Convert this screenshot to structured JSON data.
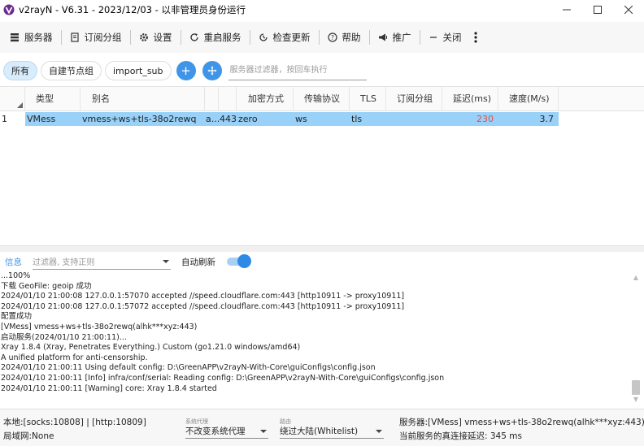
{
  "window": {
    "title": "v2rayN - V6.31 - 2023/12/03 - 以非管理员身份运行"
  },
  "toolbar": {
    "servers": "服务器",
    "subscriptions": "订阅分组",
    "settings": "设置",
    "restart": "重启服务",
    "check_update": "检查更新",
    "help": "帮助",
    "promote": "推广",
    "close": "关闭"
  },
  "filters": {
    "all": "所有",
    "custom_group": "自建节点组",
    "import_sub": "import_sub",
    "add": "+",
    "server_filter_placeholder": "服务器过滤器，按回车执行"
  },
  "grid": {
    "columns": [
      "类型",
      "别名",
      "",
      "",
      "加密方式",
      "传输协议",
      "TLS",
      "订阅分组",
      "延迟(ms)",
      "速度(M/s)"
    ],
    "rows": [
      {
        "index": "1",
        "type": "VMess",
        "alias": "vmess+ws+tls-38o2rewq",
        "address": "a...",
        "port": "443",
        "security": "zero",
        "network": "ws",
        "tls": "tls",
        "sub": "",
        "delay": "230",
        "speed": "3.7"
      }
    ]
  },
  "log_panel": {
    "tab": "信息",
    "filter_placeholder": "过滤器, 支持正则",
    "auto_refresh_label": "自动刷新",
    "auto_refresh_on": true,
    "lines": [
      "...100%",
      "下载 GeoFile: geoip 成功",
      "2024/01/10 21:00:08 127.0.0.1:57070 accepted //speed.cloudflare.com:443 [http10911 -> proxy10911]",
      "2024/01/10 21:00:08 127.0.0.1:57072 accepted //speed.cloudflare.com:443 [http10911 -> proxy10911]",
      "配置成功",
      "[VMess] vmess+ws+tls-38o2rewq(alhk***xyz:443)",
      "启动服务(2024/01/10 21:00:11)...",
      "Xray 1.8.4 (Xray, Penetrates Everything.) Custom (go1.21.0 windows/amd64)",
      "A unified platform for anti-censorship.",
      "2024/01/10 21:00:11 Using default config:  D:\\GreenAPP\\v2rayN-With-Core\\guiConfigs\\config.json",
      "2024/01/10 21:00:11 [Info] infra/conf/serial: Reading config: D:\\GreenAPP\\v2rayN-With-Core\\guiConfigs\\config.json",
      "2024/01/10 21:00:11 [Warning] core: Xray 1.8.4 started"
    ]
  },
  "status": {
    "local": "本地:[socks:10808] | [http:10809]",
    "lan": "局域网:None",
    "sysproxy_label": "系统代理",
    "sysproxy_value": "不改变系统代理",
    "route_label": "路由",
    "route_value": "绕过大陆(Whitelist)",
    "server": "服务器:[VMess] vmess+ws+tls-38o2rewq(alhk***xyz:443)",
    "latency": "当前服务的真连接延迟: 345 ms"
  },
  "colors": {
    "accent": "#3f95e8",
    "selection": "#99d1f8",
    "delay": "#d9534f"
  }
}
